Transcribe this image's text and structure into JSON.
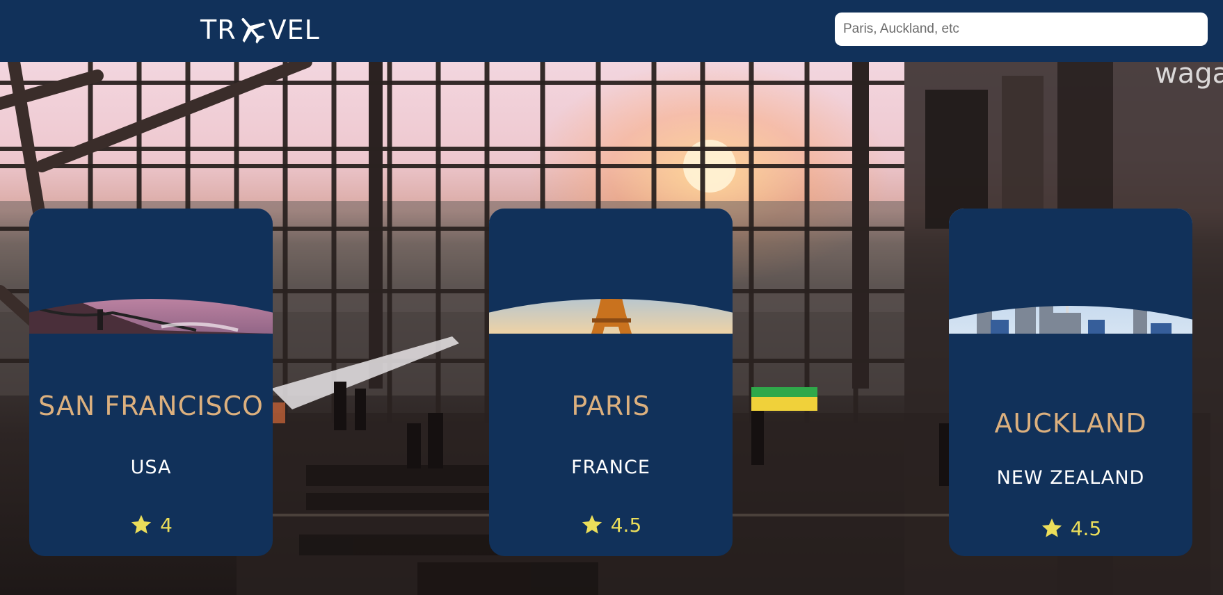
{
  "header": {
    "logo_left": "TR",
    "logo_right": "VEL",
    "logo_icon": "airplane-icon",
    "search_placeholder": "Paris, Auckland, etc"
  },
  "colors": {
    "header_bg": "#11315a",
    "card_bg": "#11315a",
    "city_text": "#dcb07e",
    "country_text": "#ffffff",
    "rating_text": "#ecde5a",
    "star": "#ecde5a"
  },
  "destinations": [
    {
      "city": "SAN FRANCISCO",
      "country": "USA",
      "rating": "4",
      "image": "golden-gate-bridge-image",
      "star_icon": "star-icon"
    },
    {
      "city": "PARIS",
      "country": "FRANCE",
      "rating": "4.5",
      "image": "eiffel-tower-image",
      "star_icon": "star-icon"
    },
    {
      "city": "AUCKLAND",
      "country": "NEW ZEALAND",
      "rating": "4.5",
      "image": "auckland-skyline-image",
      "star_icon": "star-icon"
    }
  ]
}
